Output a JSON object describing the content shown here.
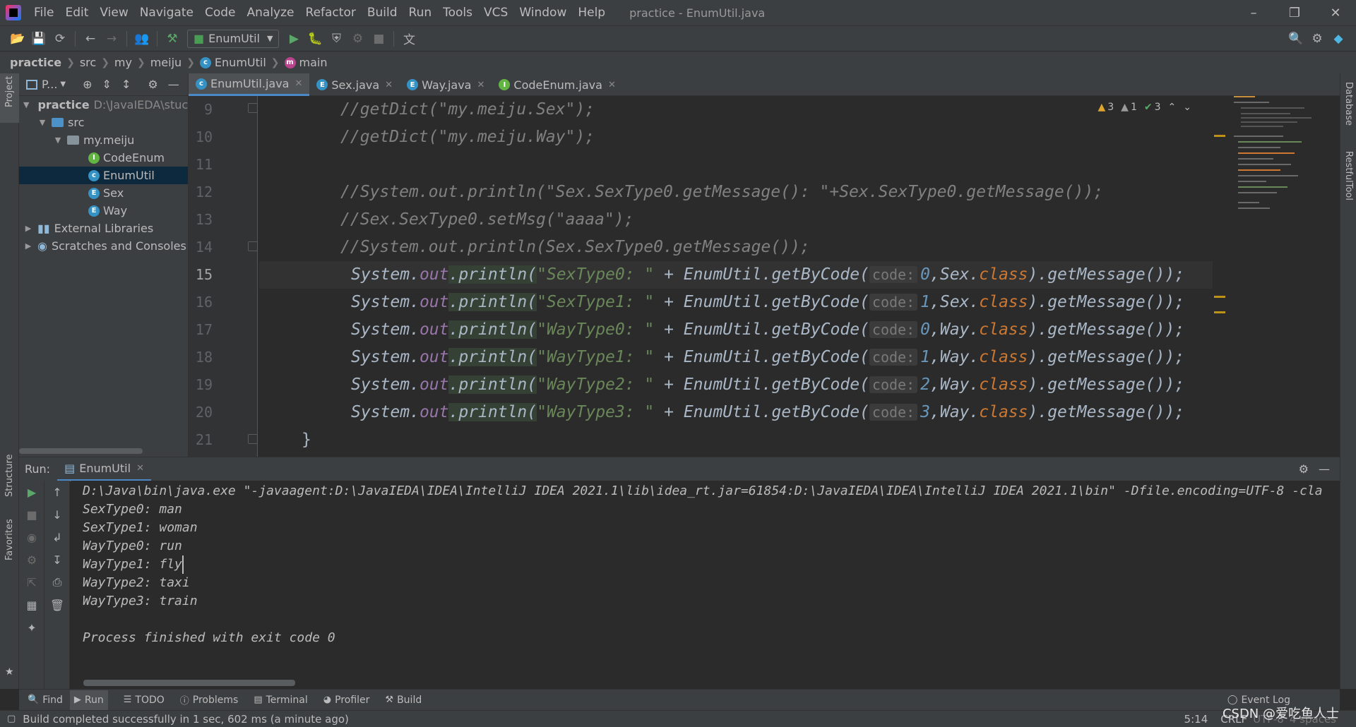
{
  "menu": [
    "File",
    "Edit",
    "View",
    "Navigate",
    "Code",
    "Analyze",
    "Refactor",
    "Build",
    "Run",
    "Tools",
    "VCS",
    "Window",
    "Help"
  ],
  "window_title": "practice - EnumUtil.java",
  "toolbar": {
    "run_config": "EnumUtil"
  },
  "breadcrumbs": [
    "practice",
    "src",
    "my",
    "meiju",
    "EnumUtil",
    "main"
  ],
  "project": {
    "header": "P...",
    "root": "practice",
    "root_path": "D:\\JavaIEDA\\stuc",
    "src": "src",
    "package": "my.meiju",
    "files": [
      "CodeEnum",
      "EnumUtil",
      "Sex",
      "Way"
    ],
    "external": "External Libraries",
    "scratches": "Scratches and Consoles"
  },
  "tabs": [
    "EnumUtil.java",
    "Sex.java",
    "Way.java",
    "CodeEnum.java"
  ],
  "inspections": {
    "warnings": "3",
    "weak_warnings": "1",
    "ok": "3"
  },
  "editor": {
    "line_numbers": [
      "9",
      "10",
      "11",
      "12",
      "13",
      "14",
      "15",
      "16",
      "17",
      "18",
      "19",
      "20",
      "21"
    ],
    "comments": [
      "//getDict(\"my.meiju.Sex\");",
      "//getDict(\"my.meiju.Way\");",
      "",
      "//System.out.println(\"Sex.SexType0.getMessage(): \"+Sex.SexType0.getMessage());",
      "//Sex.SexType0.setMsg(\"aaaa\");",
      "//System.out.println(Sex.SexType0.getMessage());"
    ],
    "calls": [
      {
        "label": "\"SexType0: \"",
        "code": "0",
        "cls": "Sex"
      },
      {
        "label": "\"SexType1: \"",
        "code": "1",
        "cls": "Sex"
      },
      {
        "label": "\"WayType0: \"",
        "code": "0",
        "cls": "Way"
      },
      {
        "label": "\"WayType1: \"",
        "code": "1",
        "cls": "Way"
      },
      {
        "label": "\"WayType2: \"",
        "code": "2",
        "cls": "Way"
      },
      {
        "label": "\"WayType3: \"",
        "code": "3",
        "cls": "Way"
      }
    ],
    "closing": "}",
    "tokens": {
      "system": "System.",
      "out": "out",
      "println": ".println(",
      "plus": " + EnumUtil.getByCode(",
      "hint": "code:",
      "comma": ",",
      "dot": ".",
      "class_kw": "class",
      "tail": ").getMessage());"
    }
  },
  "run": {
    "label": "Run:",
    "tab": "EnumUtil",
    "output": [
      "D:\\Java\\bin\\java.exe \"-javaagent:D:\\JavaIEDA\\IDEA\\IntelliJ IDEA 2021.1\\lib\\idea_rt.jar=61854:D:\\JavaIEDA\\IDEA\\IntelliJ IDEA 2021.1\\bin\" -Dfile.encoding=UTF-8 -cla",
      "SexType0: man",
      "SexType1: woman",
      "WayType0: run",
      "WayType1: fly",
      "WayType2: taxi",
      "WayType3: train",
      "",
      "Process finished with exit code 0"
    ]
  },
  "side_tools": {
    "project": "Project",
    "structure": "Structure",
    "favorites": "Favorites",
    "database": "Database",
    "restful": "RestfulTool"
  },
  "bottom_tools": [
    "Find",
    "Run",
    "TODO",
    "Problems",
    "Terminal",
    "Profiler",
    "Build"
  ],
  "event_log": "Event Log",
  "status": {
    "message": "Build completed successfully in 1 sec, 602 ms (a minute ago)",
    "position": "5:14",
    "line_sep": "CRLF",
    "encoding": "UTF-8",
    "indent": "4 spaces",
    "watermark": "CSDN @爱吃鱼人士"
  }
}
